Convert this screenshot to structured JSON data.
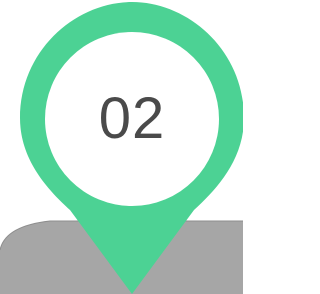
{
  "marker": {
    "number": "02",
    "icon": "map-pin-icon"
  },
  "colors": {
    "pin": "#4CD294",
    "pin_inner": "#ffffff",
    "number_text": "#4a4a4a",
    "ground": "#a6a6a6",
    "ground_edge": "#8e8e8e"
  }
}
